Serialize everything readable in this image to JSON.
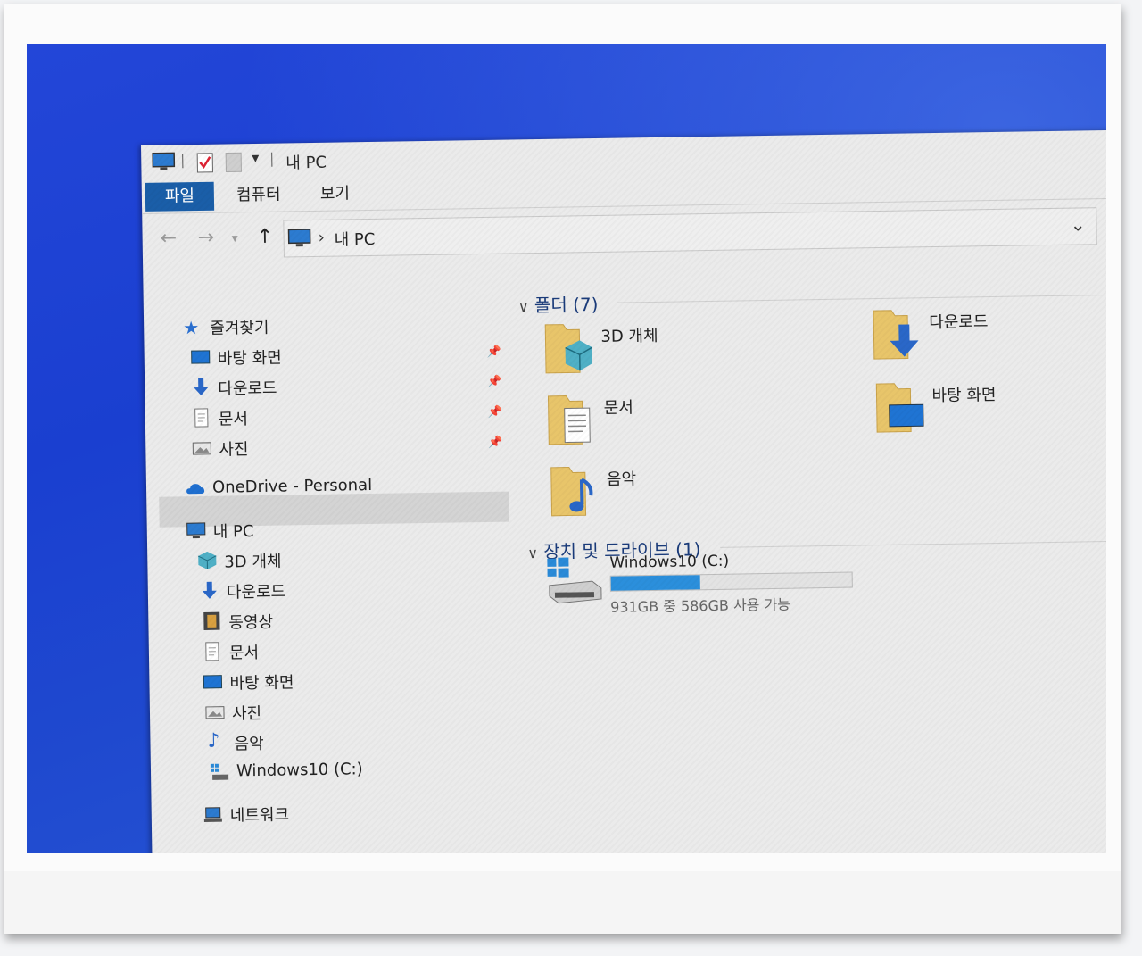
{
  "window": {
    "title": "내 PC"
  },
  "ribbon": {
    "tabs": [
      "파일",
      "컴퓨터",
      "보기"
    ]
  },
  "address": {
    "separator": "›",
    "crumb": "내 PC"
  },
  "sidebar": {
    "quick_access": {
      "label": "즐겨찾기",
      "items": [
        "바탕 화면",
        "다운로드",
        "문서",
        "사진"
      ]
    },
    "onedrive": "OneDrive - Personal",
    "this_pc": {
      "label": "내 PC",
      "items": [
        "3D 개체",
        "다운로드",
        "동영상",
        "문서",
        "바탕 화면",
        "사진",
        "음악",
        "Windows10 (C:)"
      ]
    },
    "network": "네트워크"
  },
  "content": {
    "folders_header": "폴더 (7)",
    "folders": [
      "3D 개체",
      "다운로드",
      "문서",
      "바탕 화면",
      "음악"
    ],
    "devices_header": "장치 및 드라이브 (1)",
    "drive": {
      "name": "Windows10 (C:)",
      "free_text": "931GB 중 586GB 사용 가능",
      "used_fraction": 0.37
    }
  },
  "colors": {
    "accent": "#1a5ea8",
    "folder": "#e8c56a",
    "drive_bar": "#2b8fdc",
    "wallpaper": "#2346d8"
  }
}
